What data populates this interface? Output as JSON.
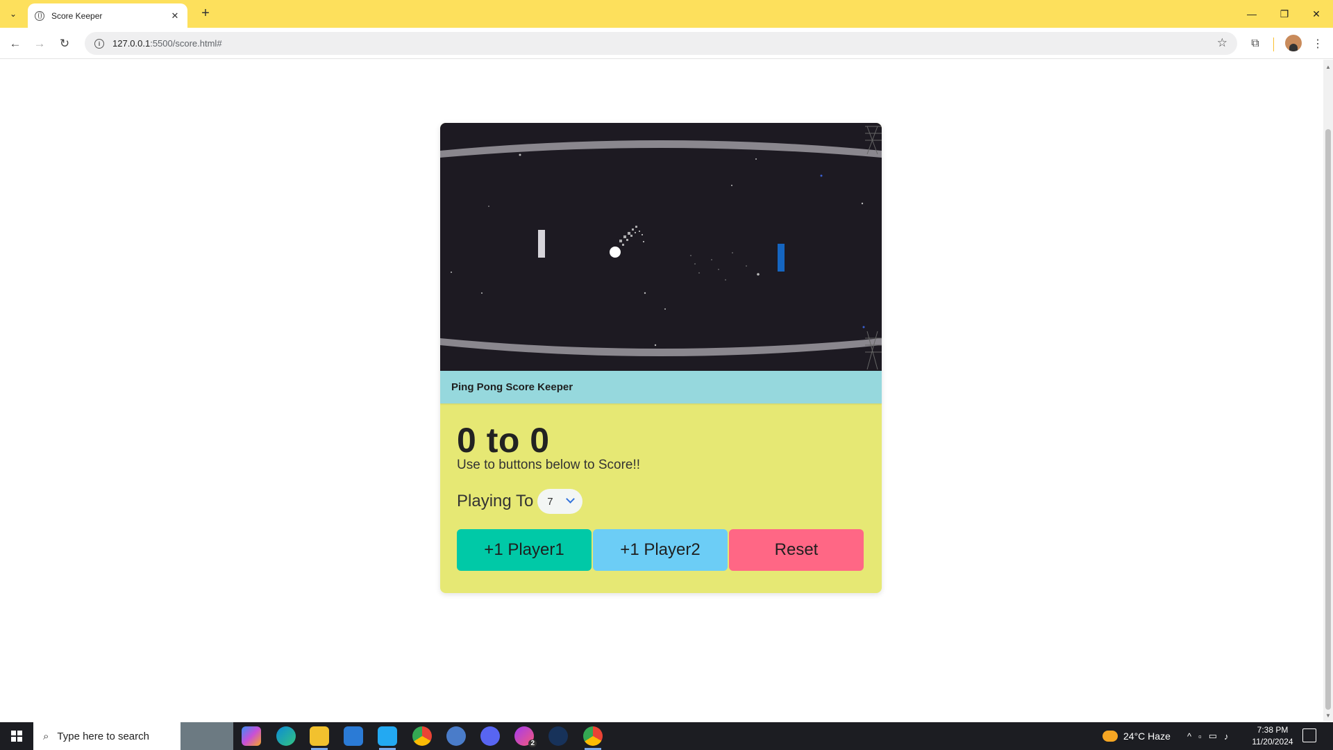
{
  "browser": {
    "tab_title": "Score Keeper",
    "tab_close": "✕",
    "new_tab": "+",
    "url_host": "127.0.0.1",
    "url_path": ":5500/score.html#",
    "back": "←",
    "forward": "→",
    "reload": "↻",
    "star": "☆",
    "window_minimize": "—",
    "window_restore": "❐",
    "window_close": "✕",
    "tab_list": "⌄",
    "extensions": "⧉",
    "menu": "⋮"
  },
  "app": {
    "header_title": "Ping Pong Score Keeper",
    "score_text": "0 to 0",
    "hint": "Use to buttons below to Score!!",
    "playing_to_label": "Playing To",
    "playing_to_value": "7",
    "buttons": {
      "player1": "+1 Player1",
      "player2": "+1 Player2",
      "reset": "Reset"
    },
    "colors": {
      "card_bg": "#e6e874",
      "header_bg": "#96d8dd",
      "player1": "#00c9a7",
      "player2": "#6ccdf6",
      "reset": "#ff6785",
      "hero_bg": "#1d1a22",
      "paddle_right": "#1565c0"
    }
  },
  "taskbar": {
    "search_placeholder": "Type here to search",
    "weather": "24°C  Haze",
    "time": "7:38 PM",
    "date": "11/20/2024",
    "apps": [
      "copilot-icon",
      "edge-icon",
      "file-explorer-icon",
      "store-icon",
      "vscode-icon",
      "chrome-icon",
      "qbittorrent-icon",
      "discord-icon",
      "messenger-icon",
      "steam-icon",
      "chrome-active-icon"
    ],
    "messenger_badge": "2"
  }
}
